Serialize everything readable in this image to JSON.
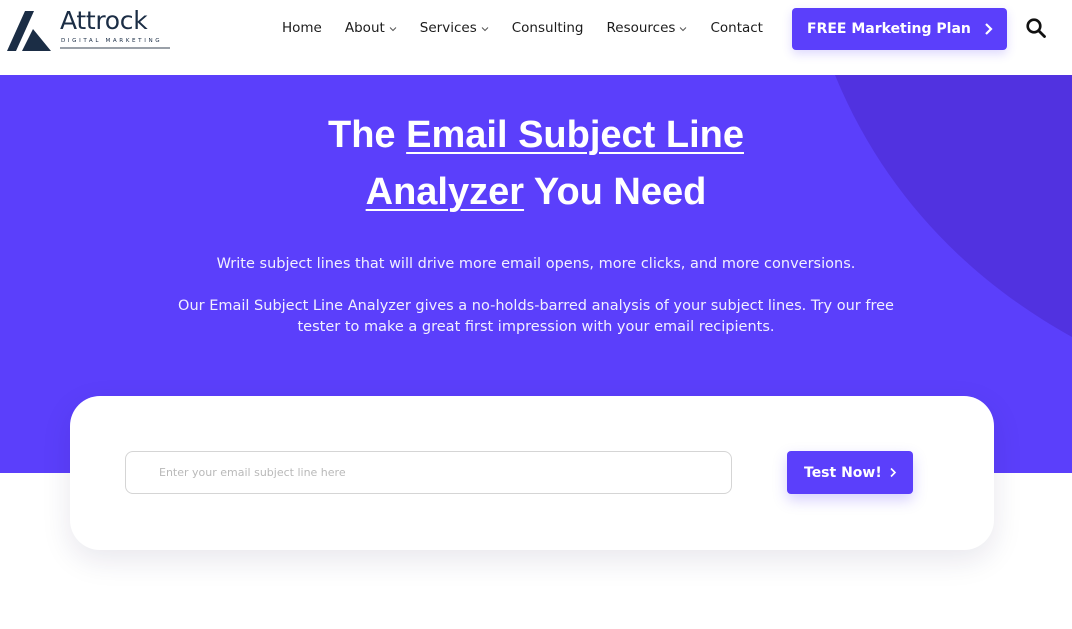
{
  "brand": {
    "name": "Attrock",
    "tagline": "DIGITAL MARKETING",
    "logo_icon": "attrock-mountain-logo",
    "primary_color": "#5b3ffb",
    "hero_accent_shape_color": "#5132e0",
    "dark_text_color": "#1b2d45"
  },
  "nav": {
    "items": [
      {
        "label": "Home",
        "has_dropdown": false
      },
      {
        "label": "About",
        "has_dropdown": true
      },
      {
        "label": "Services",
        "has_dropdown": true
      },
      {
        "label": "Consulting",
        "has_dropdown": false
      },
      {
        "label": "Resources",
        "has_dropdown": true
      },
      {
        "label": "Contact",
        "has_dropdown": false
      }
    ],
    "cta_label": "FREE Marketing Plan",
    "cta_icon": "chevron-right-icon",
    "search_icon": "search-icon"
  },
  "hero": {
    "title_part1": "The ",
    "title_underlined1": "Email Subject Line",
    "title_underlined2": "Analyzer",
    "title_part2": " You Need",
    "subtitle": "Write subject lines that will drive more email opens, more clicks, and more conversions.",
    "description": "Our Email Subject Line Analyzer gives a no-holds-barred analysis of your subject lines. Try our free tester to make a great first impression with your email recipients."
  },
  "analyzer": {
    "input_value": "",
    "input_placeholder": "Enter your email subject line here",
    "button_label": "Test Now!",
    "button_icon": "chevron-right-icon"
  }
}
